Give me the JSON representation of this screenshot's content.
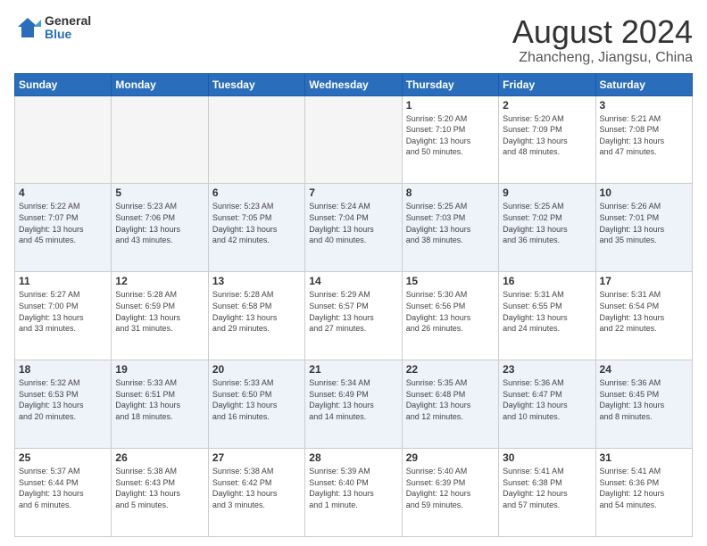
{
  "logo": {
    "general": "General",
    "blue": "Blue"
  },
  "header": {
    "title": "August 2024",
    "subtitle": "Zhancheng, Jiangsu, China"
  },
  "weekdays": [
    "Sunday",
    "Monday",
    "Tuesday",
    "Wednesday",
    "Thursday",
    "Friday",
    "Saturday"
  ],
  "weeks": [
    [
      {
        "day": "",
        "info": ""
      },
      {
        "day": "",
        "info": ""
      },
      {
        "day": "",
        "info": ""
      },
      {
        "day": "",
        "info": ""
      },
      {
        "day": "1",
        "info": "Sunrise: 5:20 AM\nSunset: 7:10 PM\nDaylight: 13 hours\nand 50 minutes."
      },
      {
        "day": "2",
        "info": "Sunrise: 5:20 AM\nSunset: 7:09 PM\nDaylight: 13 hours\nand 48 minutes."
      },
      {
        "day": "3",
        "info": "Sunrise: 5:21 AM\nSunset: 7:08 PM\nDaylight: 13 hours\nand 47 minutes."
      }
    ],
    [
      {
        "day": "4",
        "info": "Sunrise: 5:22 AM\nSunset: 7:07 PM\nDaylight: 13 hours\nand 45 minutes."
      },
      {
        "day": "5",
        "info": "Sunrise: 5:23 AM\nSunset: 7:06 PM\nDaylight: 13 hours\nand 43 minutes."
      },
      {
        "day": "6",
        "info": "Sunrise: 5:23 AM\nSunset: 7:05 PM\nDaylight: 13 hours\nand 42 minutes."
      },
      {
        "day": "7",
        "info": "Sunrise: 5:24 AM\nSunset: 7:04 PM\nDaylight: 13 hours\nand 40 minutes."
      },
      {
        "day": "8",
        "info": "Sunrise: 5:25 AM\nSunset: 7:03 PM\nDaylight: 13 hours\nand 38 minutes."
      },
      {
        "day": "9",
        "info": "Sunrise: 5:25 AM\nSunset: 7:02 PM\nDaylight: 13 hours\nand 36 minutes."
      },
      {
        "day": "10",
        "info": "Sunrise: 5:26 AM\nSunset: 7:01 PM\nDaylight: 13 hours\nand 35 minutes."
      }
    ],
    [
      {
        "day": "11",
        "info": "Sunrise: 5:27 AM\nSunset: 7:00 PM\nDaylight: 13 hours\nand 33 minutes."
      },
      {
        "day": "12",
        "info": "Sunrise: 5:28 AM\nSunset: 6:59 PM\nDaylight: 13 hours\nand 31 minutes."
      },
      {
        "day": "13",
        "info": "Sunrise: 5:28 AM\nSunset: 6:58 PM\nDaylight: 13 hours\nand 29 minutes."
      },
      {
        "day": "14",
        "info": "Sunrise: 5:29 AM\nSunset: 6:57 PM\nDaylight: 13 hours\nand 27 minutes."
      },
      {
        "day": "15",
        "info": "Sunrise: 5:30 AM\nSunset: 6:56 PM\nDaylight: 13 hours\nand 26 minutes."
      },
      {
        "day": "16",
        "info": "Sunrise: 5:31 AM\nSunset: 6:55 PM\nDaylight: 13 hours\nand 24 minutes."
      },
      {
        "day": "17",
        "info": "Sunrise: 5:31 AM\nSunset: 6:54 PM\nDaylight: 13 hours\nand 22 minutes."
      }
    ],
    [
      {
        "day": "18",
        "info": "Sunrise: 5:32 AM\nSunset: 6:53 PM\nDaylight: 13 hours\nand 20 minutes."
      },
      {
        "day": "19",
        "info": "Sunrise: 5:33 AM\nSunset: 6:51 PM\nDaylight: 13 hours\nand 18 minutes."
      },
      {
        "day": "20",
        "info": "Sunrise: 5:33 AM\nSunset: 6:50 PM\nDaylight: 13 hours\nand 16 minutes."
      },
      {
        "day": "21",
        "info": "Sunrise: 5:34 AM\nSunset: 6:49 PM\nDaylight: 13 hours\nand 14 minutes."
      },
      {
        "day": "22",
        "info": "Sunrise: 5:35 AM\nSunset: 6:48 PM\nDaylight: 13 hours\nand 12 minutes."
      },
      {
        "day": "23",
        "info": "Sunrise: 5:36 AM\nSunset: 6:47 PM\nDaylight: 13 hours\nand 10 minutes."
      },
      {
        "day": "24",
        "info": "Sunrise: 5:36 AM\nSunset: 6:45 PM\nDaylight: 13 hours\nand 8 minutes."
      }
    ],
    [
      {
        "day": "25",
        "info": "Sunrise: 5:37 AM\nSunset: 6:44 PM\nDaylight: 13 hours\nand 6 minutes."
      },
      {
        "day": "26",
        "info": "Sunrise: 5:38 AM\nSunset: 6:43 PM\nDaylight: 13 hours\nand 5 minutes."
      },
      {
        "day": "27",
        "info": "Sunrise: 5:38 AM\nSunset: 6:42 PM\nDaylight: 13 hours\nand 3 minutes."
      },
      {
        "day": "28",
        "info": "Sunrise: 5:39 AM\nSunset: 6:40 PM\nDaylight: 13 hours\nand 1 minute."
      },
      {
        "day": "29",
        "info": "Sunrise: 5:40 AM\nSunset: 6:39 PM\nDaylight: 12 hours\nand 59 minutes."
      },
      {
        "day": "30",
        "info": "Sunrise: 5:41 AM\nSunset: 6:38 PM\nDaylight: 12 hours\nand 57 minutes."
      },
      {
        "day": "31",
        "info": "Sunrise: 5:41 AM\nSunset: 6:36 PM\nDaylight: 12 hours\nand 54 minutes."
      }
    ]
  ]
}
